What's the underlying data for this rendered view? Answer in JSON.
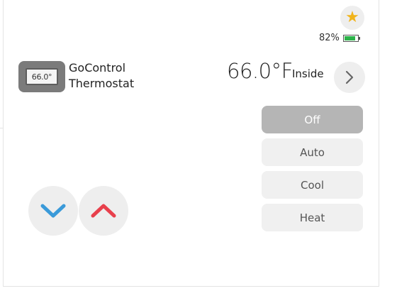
{
  "favorite": {
    "icon": "star-icon",
    "color": "#f1b41b",
    "symbol": "★"
  },
  "battery": {
    "percent_label": "82%",
    "level": 0.82,
    "color": "#2db34a",
    "icon": "battery-icon"
  },
  "device": {
    "icon": "thermostat-device-icon",
    "screen_text": "66.0°",
    "name_line1": "GoControl",
    "name_line2": "Thermostat"
  },
  "reading": {
    "temperature": "66.0°F",
    "label": "Inside"
  },
  "details_button": {
    "icon": "chevron-right-icon"
  },
  "modes": [
    {
      "label": "Off",
      "active": true
    },
    {
      "label": "Auto",
      "active": false
    },
    {
      "label": "Cool",
      "active": false
    },
    {
      "label": "Heat",
      "active": false
    }
  ],
  "setpoint_controls": {
    "decrease": {
      "icon": "chevron-down-icon",
      "color": "#3a9ad9"
    },
    "increase": {
      "icon": "chevron-up-icon",
      "color": "#e8404c"
    }
  }
}
